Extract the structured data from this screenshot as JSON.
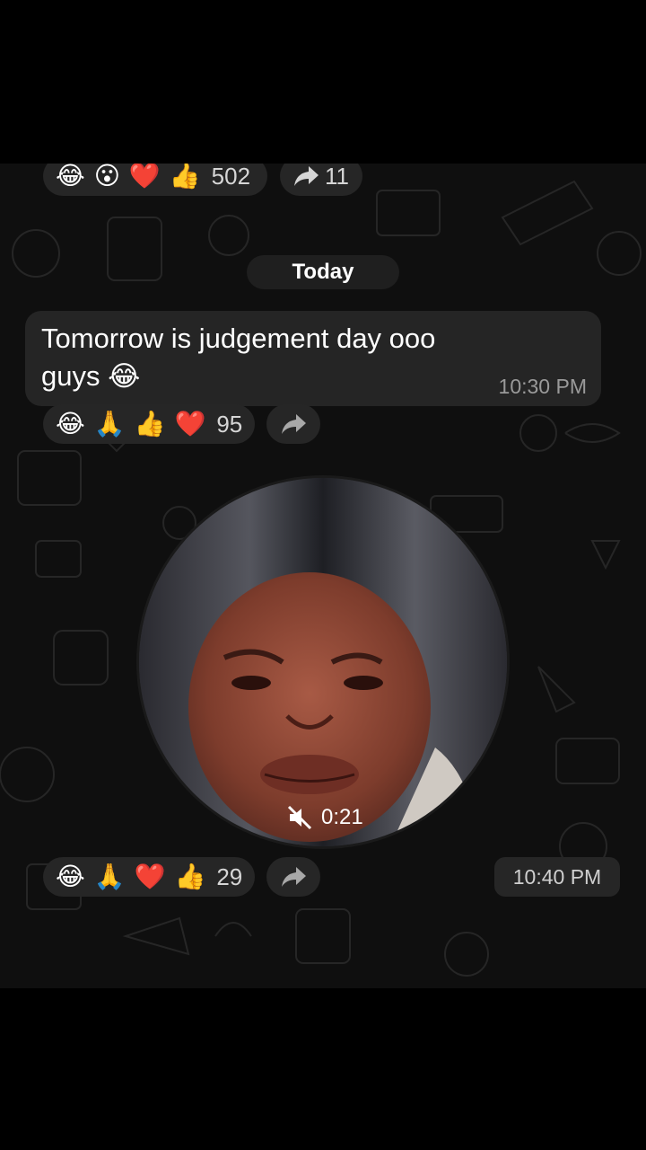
{
  "top_reactions": {
    "emojis": [
      "😂",
      "😮",
      "❤️",
      "👍"
    ],
    "count": "502",
    "forward_count": "11"
  },
  "date_separator": "Today",
  "message": {
    "text_line1": "Tomorrow is judgement day ooo",
    "text_line2": "guys 😂",
    "time": "10:30 PM",
    "reactions": {
      "emojis": [
        "😂",
        "🙏",
        "👍",
        "❤️"
      ],
      "count": "95"
    }
  },
  "video_message": {
    "duration": "0:21",
    "muted": true,
    "time": "10:40 PM",
    "reactions": {
      "emojis": [
        "😂",
        "🙏",
        "❤️",
        "👍"
      ],
      "count": "29"
    }
  },
  "colors": {
    "background": "#0f0f0f",
    "bubble": "#252525",
    "reaction_pill": "#262626",
    "heart": "#e0202a"
  },
  "icons": [
    "forward-icon",
    "muted-speaker-icon"
  ]
}
